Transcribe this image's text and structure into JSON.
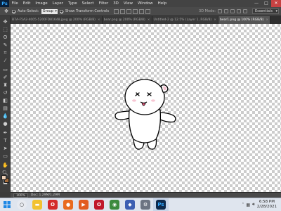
{
  "app": {
    "logo": "Ps"
  },
  "menu": [
    "File",
    "Edit",
    "Image",
    "Layer",
    "Type",
    "Select",
    "Filter",
    "3D",
    "View",
    "Window",
    "Help"
  ],
  "window_controls": {
    "minimize": "—",
    "maximize": "□",
    "close": "✕"
  },
  "options": {
    "auto_select_label": "Auto-Select:",
    "auto_select_value": "Group",
    "show_transform_label": "Show Transform Controls",
    "mode_3d_label": "3D Mode:",
    "workspace": "Essentials"
  },
  "tabs": [
    {
      "label": "B7A-F5A2-4005-5200FD81648.jpeg @ 200% (RGB/8)",
      "active": false
    },
    {
      "label": "bear.png @ 200% (RGB/8)",
      "active": false
    },
    {
      "label": "Untitled-2 @ 12.5% (Layer 1, RGB/8)",
      "active": false
    },
    {
      "label": "bear1.png @ 100% (RGB/8)",
      "active": true
    }
  ],
  "status": {
    "zoom": "100%",
    "doc_info": "Doc: 1.29M/1.29M"
  },
  "taskbar": {
    "apps": [
      {
        "name": "search",
        "glyph": "○",
        "color": "#e7eaf0"
      },
      {
        "name": "file-explorer",
        "glyph": "▬",
        "color": "#f2c230"
      },
      {
        "name": "opera",
        "glyph": "O",
        "color": "#d42a2a"
      },
      {
        "name": "firefox",
        "glyph": "●",
        "color": "#e96b1f"
      },
      {
        "name": "media-player",
        "glyph": "▶",
        "color": "#e25b1f"
      },
      {
        "name": "opera-gx",
        "glyph": "O",
        "color": "#c0182b"
      },
      {
        "name": "chrome",
        "glyph": "◉",
        "color": "#3c8a3c"
      },
      {
        "name": "app-b",
        "glyph": "◆",
        "color": "#3d5fb2"
      },
      {
        "name": "settings",
        "glyph": "⚙",
        "color": "#6c7482"
      },
      {
        "name": "photoshop",
        "glyph": "Ps",
        "color": "#0d2a4d"
      }
    ],
    "time": "6:58 PM",
    "date": "2/28/2021"
  },
  "colors": {
    "foreground": "#f0d2b8",
    "background": "#a46c3c"
  }
}
